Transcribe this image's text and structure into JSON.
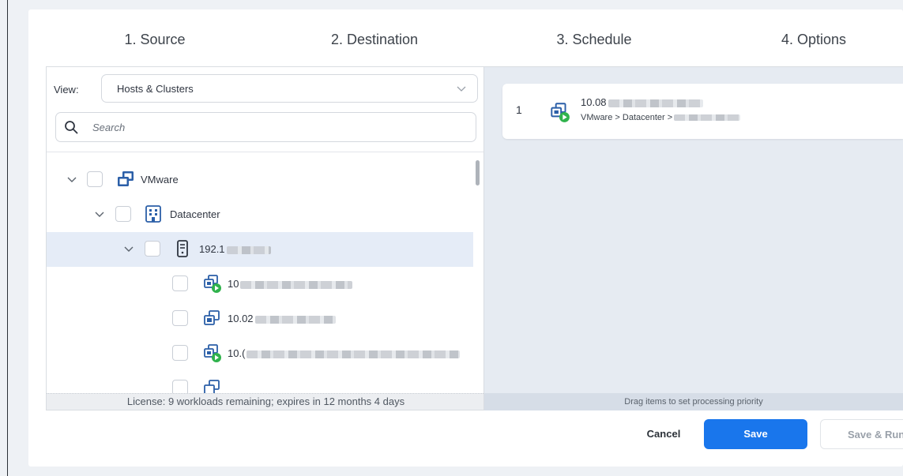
{
  "tabs": [
    "1. Source",
    "2. Destination",
    "3. Schedule",
    "4. Options"
  ],
  "view": {
    "label": "View:",
    "selected": "Hosts & Clusters"
  },
  "search": {
    "placeholder": "Search"
  },
  "tree": {
    "root": {
      "label": "VMware",
      "icon": "vmware-icon"
    },
    "datacenter": {
      "label": "Datacenter",
      "icon": "datacenter-icon"
    },
    "host": {
      "label": "192.1",
      "icon": "host-server-icon"
    },
    "vms": [
      {
        "label": "10",
        "icon": "vm-running-icon"
      },
      {
        "label": "10.02",
        "icon": "vm-icon"
      },
      {
        "label": "10.(",
        "icon": "vm-running-icon"
      }
    ]
  },
  "license_text": "License: 9 workloads remaining; expires in 12 months 4 days",
  "queue": [
    {
      "index": "1",
      "name": "10.08",
      "path": "VMware > Datacenter >",
      "icon": "vm-running-icon"
    }
  ],
  "drag_hint": "Drag items to set processing priority",
  "buttons": {
    "cancel": "Cancel",
    "save": "Save",
    "save_run": "Save & Run"
  },
  "colors": {
    "primary": "#1976ec",
    "icon_blue": "#2b5fa8",
    "running_green": "#2fb24c",
    "selected_row": "#e5ecf7"
  }
}
